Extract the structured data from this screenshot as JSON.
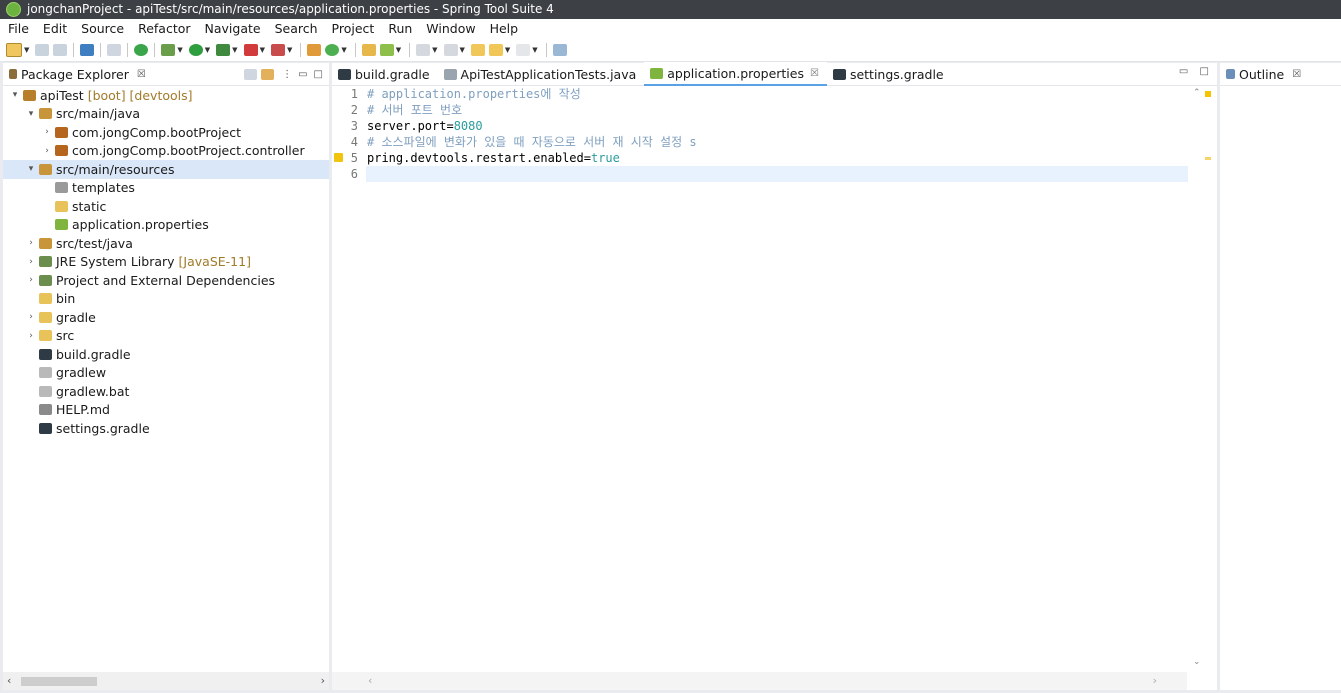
{
  "window": {
    "title": "jongchanProject - apiTest/src/main/resources/application.properties - Spring Tool Suite 4"
  },
  "menu": [
    "File",
    "Edit",
    "Source",
    "Refactor",
    "Navigate",
    "Search",
    "Project",
    "Run",
    "Window",
    "Help"
  ],
  "package_explorer": {
    "title": "Package Explorer",
    "tree": [
      {
        "label": "apiTest",
        "deco": "[boot] [devtools]",
        "indent": 0,
        "twisty": "▾",
        "icon": "project-icon",
        "color": "#b87f2a"
      },
      {
        "label": "src/main/java",
        "indent": 1,
        "twisty": "▾",
        "icon": "source-folder-icon",
        "color": "#c9953b"
      },
      {
        "label": "com.jongComp.bootProject",
        "indent": 2,
        "twisty": "›",
        "icon": "package-icon",
        "color": "#b5651d"
      },
      {
        "label": "com.jongComp.bootProject.controller",
        "indent": 2,
        "twisty": "›",
        "icon": "package-icon",
        "color": "#b5651d"
      },
      {
        "label": "src/main/resources",
        "indent": 1,
        "twisty": "▾",
        "icon": "source-folder-icon",
        "color": "#c9953b",
        "selected": true
      },
      {
        "label": "templates",
        "indent": 2,
        "twisty": "",
        "icon": "empty-package-icon",
        "color": "#9a9a9a"
      },
      {
        "label": "static",
        "indent": 2,
        "twisty": "",
        "icon": "folder-icon",
        "color": "#e8c35a"
      },
      {
        "label": "application.properties",
        "indent": 2,
        "twisty": "",
        "icon": "properties-file-icon",
        "color": "#7fb43e"
      },
      {
        "label": "src/test/java",
        "indent": 1,
        "twisty": "›",
        "icon": "source-folder-icon",
        "color": "#c9953b"
      },
      {
        "label": "JRE System Library",
        "deco": "[JavaSE-11]",
        "indent": 1,
        "twisty": "›",
        "icon": "library-icon",
        "color": "#6b8e4e"
      },
      {
        "label": "Project and External Dependencies",
        "indent": 1,
        "twisty": "›",
        "icon": "library-icon",
        "color": "#6b8e4e"
      },
      {
        "label": "bin",
        "indent": 1,
        "twisty": "",
        "icon": "folder-icon",
        "color": "#e8c35a"
      },
      {
        "label": "gradle",
        "indent": 1,
        "twisty": "›",
        "icon": "folder-icon",
        "color": "#e8c35a"
      },
      {
        "label": "src",
        "indent": 1,
        "twisty": "›",
        "icon": "folder-icon",
        "color": "#e8c35a"
      },
      {
        "label": "build.gradle",
        "indent": 1,
        "twisty": "",
        "icon": "gradle-icon",
        "color": "#2e3b44"
      },
      {
        "label": "gradlew",
        "indent": 1,
        "twisty": "",
        "icon": "file-icon",
        "color": "#b9b9b9"
      },
      {
        "label": "gradlew.bat",
        "indent": 1,
        "twisty": "",
        "icon": "file-icon",
        "color": "#b9b9b9"
      },
      {
        "label": "HELP.md",
        "indent": 1,
        "twisty": "",
        "icon": "markdown-file-icon",
        "color": "#8a8a8a"
      },
      {
        "label": "settings.gradle",
        "indent": 1,
        "twisty": "",
        "icon": "gradle-icon",
        "color": "#2e3b44"
      }
    ]
  },
  "editor": {
    "tabs": [
      {
        "label": "build.gradle",
        "icon": "gradle-icon",
        "active": false
      },
      {
        "label": "ApiTestApplicationTests.java",
        "icon": "java-file-icon",
        "active": false
      },
      {
        "label": "application.properties",
        "icon": "properties-file-icon",
        "active": true,
        "close": "☒"
      },
      {
        "label": "settings.gradle",
        "icon": "gradle-icon",
        "active": false
      }
    ],
    "line_numbers": [
      "1",
      "2",
      "3",
      "4",
      "5",
      "6"
    ],
    "lines": [
      {
        "parts": [
          {
            "t": "# application.properties에 작성",
            "c": "cmt"
          }
        ]
      },
      {
        "parts": [
          {
            "t": "# 서버 포트 번호",
            "c": "cmt"
          }
        ]
      },
      {
        "parts": [
          {
            "t": "server.port=",
            "c": "key"
          },
          {
            "t": "8080",
            "c": "val"
          }
        ]
      },
      {
        "parts": [
          {
            "t": "# 소스파일에 변화가 있을 때 자동으로 서버 재 시작 설정 s",
            "c": "cmt"
          }
        ]
      },
      {
        "parts": [
          {
            "t": "pring.devtools.restart.enabled=",
            "c": "key"
          },
          {
            "t": "true",
            "c": "val"
          }
        ]
      },
      {
        "parts": [
          {
            "t": "",
            "c": "key"
          }
        ]
      }
    ]
  },
  "outline": {
    "title": "Outline"
  },
  "colors": {
    "accent": "#5aa1e6",
    "selection": "#dae7f8",
    "current_line": "#e8f2fe"
  }
}
